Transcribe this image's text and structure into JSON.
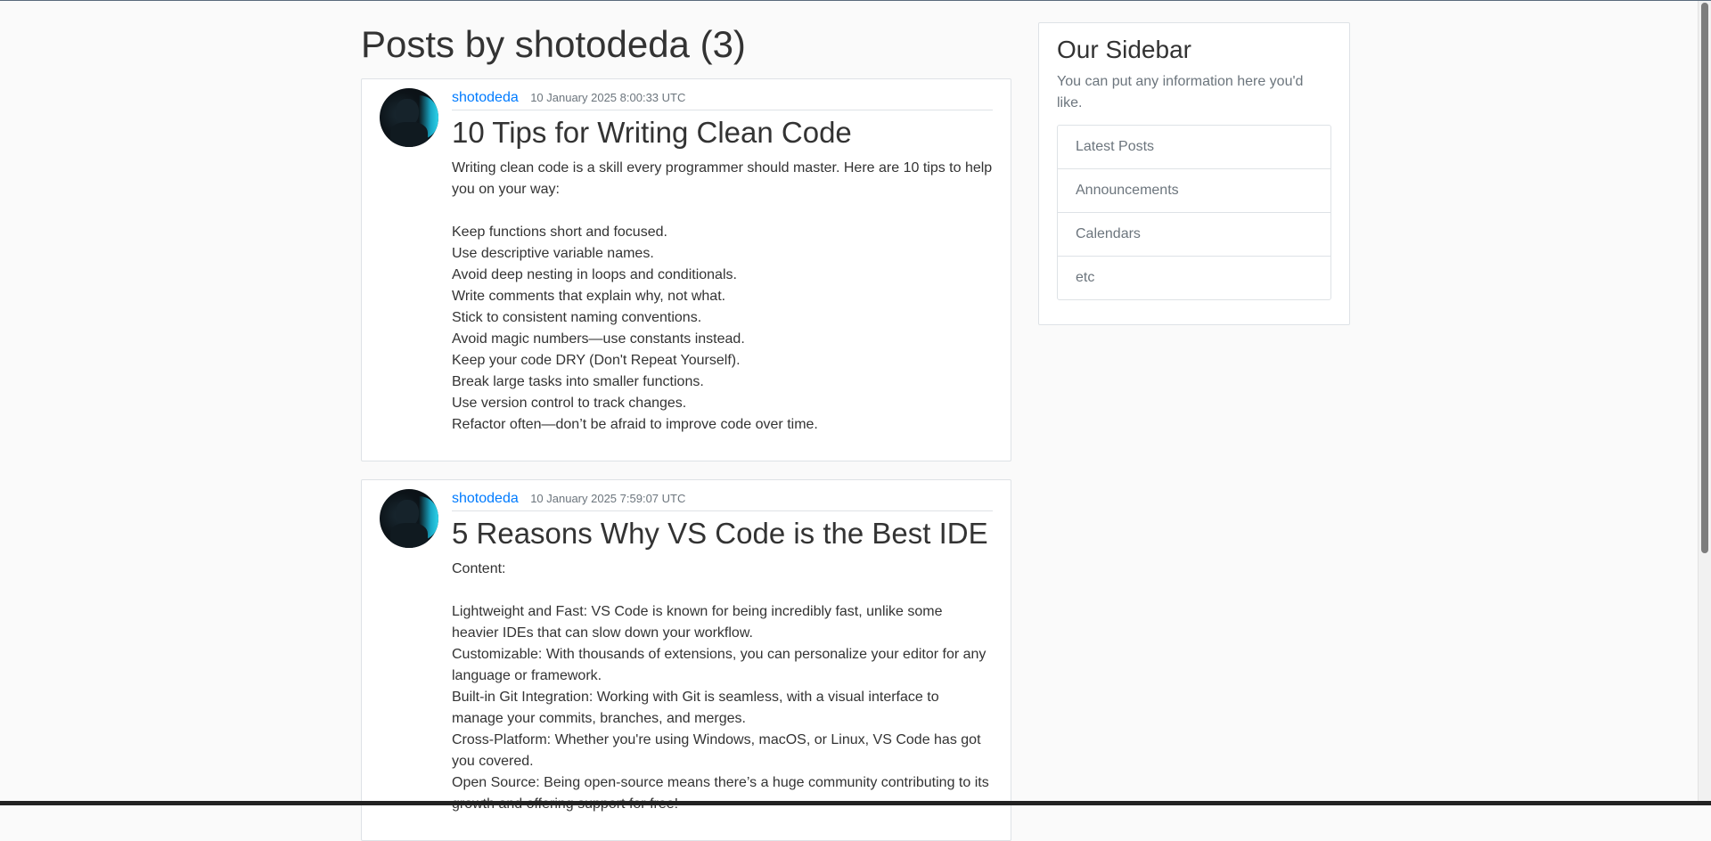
{
  "page": {
    "title": "Posts by shotodeda (3)"
  },
  "posts": [
    {
      "author": "shotodeda",
      "date": "10 January 2025 8:00:33 UTC",
      "title": "10 Tips for Writing Clean Code",
      "intro": "Writing clean code is a skill every programmer should master. Here are 10 tips to help you on your way:",
      "lines": [
        "Keep functions short and focused.",
        "Use descriptive variable names.",
        "Avoid deep nesting in loops and conditionals.",
        "Write comments that explain why, not what.",
        "Stick to consistent naming conventions.",
        "Avoid magic numbers—use constants instead.",
        "Keep your code DRY (Don't Repeat Yourself).",
        "Break large tasks into smaller functions.",
        "Use version control to track changes.",
        "Refactor often—don’t be afraid to improve code over time."
      ]
    },
    {
      "author": "shotodeda",
      "date": "10 January 2025 7:59:07 UTC",
      "title": "5 Reasons Why VS Code is the Best IDE",
      "intro": "Content:",
      "lines": [
        "Lightweight and Fast: VS Code is known for being incredibly fast, unlike some heavier IDEs that can slow down your workflow.",
        "Customizable: With thousands of extensions, you can personalize your editor for any language or framework.",
        "Built-in Git Integration: Working with Git is seamless, with a visual interface to manage your commits, branches, and merges.",
        "Cross-Platform: Whether you're using Windows, macOS, or Linux, VS Code has got you covered.",
        "Open Source: Being open-source means there’s a huge community contributing to its growth and offering support for free!"
      ]
    }
  ],
  "sidebar": {
    "title": "Our Sidebar",
    "description": "You can put any information here you'd like.",
    "items": [
      "Latest Posts",
      "Announcements",
      "Calendars",
      "etc"
    ]
  }
}
